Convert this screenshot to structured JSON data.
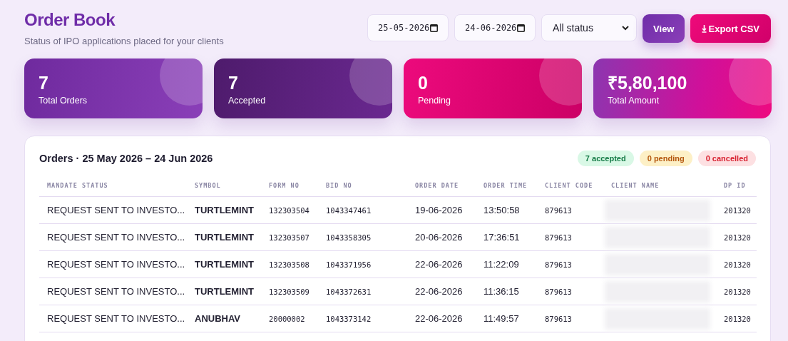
{
  "header": {
    "title": "Order Book",
    "subtitle": "Status of IPO applications placed for your clients"
  },
  "filters": {
    "from_date": "25-05-2026",
    "to_date": "24-06-2026",
    "status": "All status",
    "view_button": "View",
    "export_button": "Export CSV"
  },
  "stats": [
    {
      "value": "7",
      "label": "Total Orders",
      "kind": "purple"
    },
    {
      "value": "7",
      "label": "Accepted",
      "kind": "dark"
    },
    {
      "value": "0",
      "label": "Pending",
      "kind": "pink"
    },
    {
      "value": "₹5,80,100",
      "label": "Total Amount",
      "kind": "mixed"
    }
  ],
  "orders": {
    "title": "Orders · 25 May 2026 – 24 Jun 2026",
    "badges": [
      {
        "text": "7 accepted",
        "kind": "accepted"
      },
      {
        "text": "0 pending",
        "kind": "pending"
      },
      {
        "text": "0 cancelled",
        "kind": "cancelled"
      }
    ],
    "columns": [
      "MANDATE STATUS",
      "SYMBOL",
      "FORM NO",
      "BID NO",
      "ORDER DATE",
      "ORDER TIME",
      "CLIENT CODE",
      "CLIENT NAME",
      "DP ID"
    ],
    "rows": [
      {
        "mandate_status": "REQUEST SENT TO INVESTO...",
        "symbol": "TURTLEMINT",
        "form_no": "132303504",
        "bid_no": "1043347461",
        "order_date": "19-06-2026",
        "order_time": "13:50:58",
        "client_code": "879613",
        "dp_id": "201320"
      },
      {
        "mandate_status": "REQUEST SENT TO INVESTO...",
        "symbol": "TURTLEMINT",
        "form_no": "132303507",
        "bid_no": "1043358305",
        "order_date": "20-06-2026",
        "order_time": "17:36:51",
        "client_code": "879613",
        "dp_id": "201320"
      },
      {
        "mandate_status": "REQUEST SENT TO INVESTO...",
        "symbol": "TURTLEMINT",
        "form_no": "132303508",
        "bid_no": "1043371956",
        "order_date": "22-06-2026",
        "order_time": "11:22:09",
        "client_code": "879613",
        "dp_id": "201320"
      },
      {
        "mandate_status": "REQUEST SENT TO INVESTO...",
        "symbol": "TURTLEMINT",
        "form_no": "132303509",
        "bid_no": "1043372631",
        "order_date": "22-06-2026",
        "order_time": "11:36:15",
        "client_code": "879613",
        "dp_id": "201320"
      },
      {
        "mandate_status": "REQUEST SENT TO INVESTO...",
        "symbol": "ANUBHAV",
        "form_no": "20000002",
        "bid_no": "1043373142",
        "order_date": "22-06-2026",
        "order_time": "11:49:57",
        "client_code": "879613",
        "dp_id": "201320"
      }
    ]
  }
}
